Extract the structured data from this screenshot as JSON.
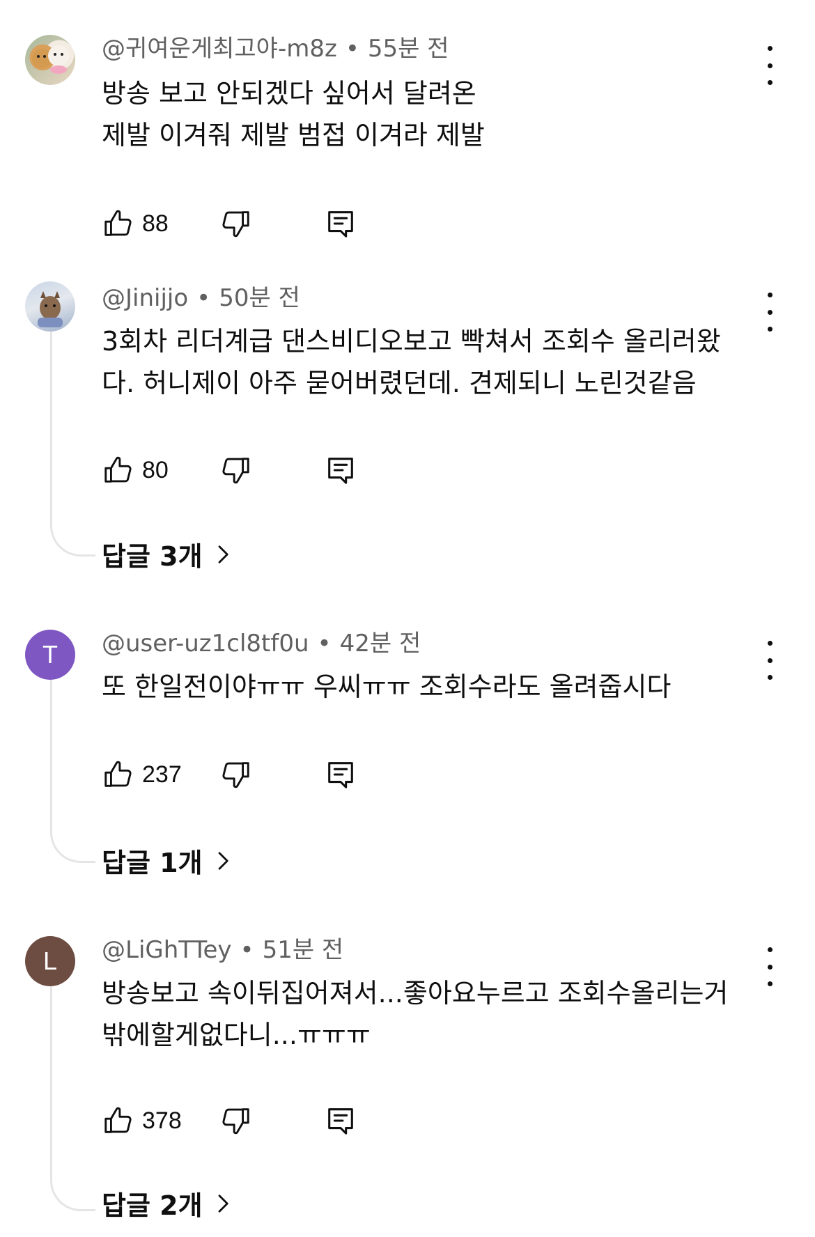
{
  "comments": [
    {
      "author": "@귀여운게최고야-m8z",
      "time": "55분 전",
      "lines": [
        "방송 보고 안되겠다 싶어서 달려온",
        "제발 이겨줘 제발 범접 이겨라 제발"
      ],
      "likes": "88",
      "avatar": {
        "type": "photo",
        "description": "dogs"
      }
    },
    {
      "author": "@Jinijjo",
      "time": "50분 전",
      "lines": [
        "3회차 리더계급 댄스비디오보고 빡쳐서 조회수 올리러왔",
        "다. 허니제이 아주 묻어버렸던데. 견제되니 노린것같음"
      ],
      "likes": "80",
      "replies": "답글 3개",
      "avatar": {
        "type": "photo",
        "description": "dog"
      }
    },
    {
      "author": "@user-uz1cl8tf0u",
      "time": "42분 전",
      "lines": [
        "또 한일전이야ㅠㅠ 우씨ㅠㅠ 조회수라도 올려줍시다"
      ],
      "likes": "237",
      "replies": "답글 1개",
      "avatar": {
        "type": "letter",
        "letter": "T",
        "color": "#7e57c2"
      }
    },
    {
      "author": "@LiGhTTey",
      "time": "51분 전",
      "lines": [
        "방송보고 속이뒤집어져서...좋아요누르고 조회수올리는거",
        "밖에할게없다니...ㅠㅠㅠ"
      ],
      "likes": "378",
      "replies": "답글 2개",
      "avatar": {
        "type": "letter",
        "letter": "L",
        "color": "#6d4c41"
      }
    }
  ]
}
